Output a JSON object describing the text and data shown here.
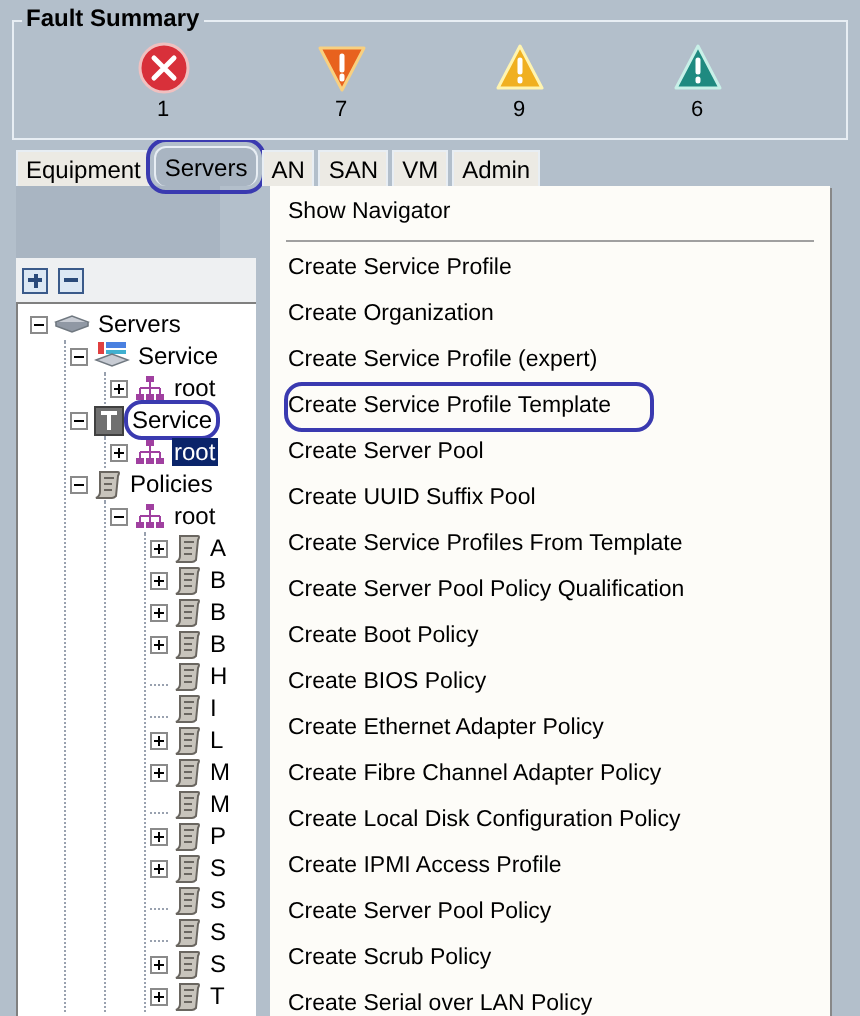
{
  "fault_summary": {
    "title": "Fault Summary",
    "faults": [
      {
        "kind": "critical",
        "count": "1"
      },
      {
        "kind": "major",
        "count": "7"
      },
      {
        "kind": "minor",
        "count": "9"
      },
      {
        "kind": "warning",
        "count": "6"
      }
    ]
  },
  "tabs": [
    {
      "label": "Equipment",
      "selected": false,
      "annotated": false
    },
    {
      "label": "Servers",
      "selected": true,
      "annotated": true
    },
    {
      "label": "AN",
      "selected": false,
      "annotated": false
    },
    {
      "label": "SAN",
      "selected": false,
      "annotated": false
    },
    {
      "label": "VM",
      "selected": false,
      "annotated": false
    },
    {
      "label": "Admin",
      "selected": false,
      "annotated": false
    }
  ],
  "toolbar": [
    {
      "kind": "expand"
    },
    {
      "kind": "collapse"
    }
  ],
  "tree": [
    {
      "label": "Servers",
      "kind": "server",
      "expandable": true,
      "expanded": true,
      "selected": false,
      "annotated": false,
      "children": [
        {
          "label": "Service",
          "kind": "profile",
          "expandable": true,
          "expanded": true,
          "selected": false,
          "annotated": false,
          "children": [
            {
              "label": "root",
              "kind": "org",
              "expandable": true,
              "expanded": false,
              "selected": false,
              "annotated": false
            }
          ]
        },
        {
          "label": "Service",
          "kind": "template",
          "expandable": true,
          "expanded": true,
          "selected": false,
          "annotated": true,
          "children": [
            {
              "label": "root",
              "kind": "org",
              "expandable": true,
              "expanded": false,
              "selected": true,
              "annotated": false
            }
          ]
        },
        {
          "label": "Policies",
          "kind": "policy",
          "expandable": true,
          "expanded": true,
          "selected": false,
          "annotated": false,
          "children": [
            {
              "label": "root",
              "kind": "org",
              "expandable": true,
              "expanded": true,
              "selected": false,
              "annotated": false,
              "children": [
                {
                  "label": "A",
                  "kind": "policy",
                  "expandable": true,
                  "expanded": false,
                  "selected": false,
                  "annotated": false
                },
                {
                  "label": "B",
                  "kind": "policy",
                  "expandable": true,
                  "expanded": false,
                  "selected": false,
                  "annotated": false
                },
                {
                  "label": "B",
                  "kind": "policy",
                  "expandable": true,
                  "expanded": false,
                  "selected": false,
                  "annotated": false
                },
                {
                  "label": "B",
                  "kind": "policy",
                  "expandable": true,
                  "expanded": false,
                  "selected": false,
                  "annotated": false
                },
                {
                  "label": "H",
                  "kind": "policy",
                  "expandable": false,
                  "selected": false,
                  "annotated": false
                },
                {
                  "label": "I",
                  "kind": "policy",
                  "expandable": false,
                  "selected": false,
                  "annotated": false
                },
                {
                  "label": "L",
                  "kind": "policy",
                  "expandable": true,
                  "expanded": false,
                  "selected": false,
                  "annotated": false
                },
                {
                  "label": "M",
                  "kind": "policy",
                  "expandable": true,
                  "expanded": false,
                  "selected": false,
                  "annotated": false
                },
                {
                  "label": "M",
                  "kind": "policy",
                  "expandable": false,
                  "selected": false,
                  "annotated": false
                },
                {
                  "label": "P",
                  "kind": "policy",
                  "expandable": true,
                  "expanded": false,
                  "selected": false,
                  "annotated": false
                },
                {
                  "label": "S",
                  "kind": "policy",
                  "expandable": true,
                  "expanded": false,
                  "selected": false,
                  "annotated": false
                },
                {
                  "label": "S",
                  "kind": "policy",
                  "expandable": false,
                  "selected": false,
                  "annotated": false
                },
                {
                  "label": "S",
                  "kind": "policy",
                  "expandable": false,
                  "selected": false,
                  "annotated": false
                },
                {
                  "label": "S",
                  "kind": "policy",
                  "expandable": true,
                  "expanded": false,
                  "selected": false,
                  "annotated": false
                },
                {
                  "label": "T",
                  "kind": "policy",
                  "expandable": true,
                  "expanded": false,
                  "selected": false,
                  "annotated": false
                }
              ]
            }
          ]
        }
      ]
    }
  ],
  "context_menu": [
    {
      "label": "Show Navigator",
      "separator_after": true,
      "annotated": false
    },
    {
      "label": "Create Service Profile",
      "separator_after": false,
      "annotated": false
    },
    {
      "label": "Create Organization",
      "separator_after": false,
      "annotated": false
    },
    {
      "label": "Create Service Profile (expert)",
      "separator_after": false,
      "annotated": false
    },
    {
      "label": "Create Service Profile Template",
      "separator_after": false,
      "annotated": true
    },
    {
      "label": "Create Server Pool",
      "separator_after": false,
      "annotated": false
    },
    {
      "label": "Create UUID Suffix Pool",
      "separator_after": false,
      "annotated": false
    },
    {
      "label": "Create Service Profiles From Template",
      "separator_after": false,
      "annotated": false
    },
    {
      "label": "Create Server Pool Policy Qualification",
      "separator_after": false,
      "annotated": false
    },
    {
      "label": "Create Boot Policy",
      "separator_after": false,
      "annotated": false
    },
    {
      "label": "Create BIOS Policy",
      "separator_after": false,
      "annotated": false
    },
    {
      "label": "Create Ethernet Adapter Policy",
      "separator_after": false,
      "annotated": false
    },
    {
      "label": "Create Fibre Channel Adapter Policy",
      "separator_after": false,
      "annotated": false
    },
    {
      "label": "Create Local Disk Configuration Policy",
      "separator_after": false,
      "annotated": false
    },
    {
      "label": "Create IPMI Access Profile",
      "separator_after": false,
      "annotated": false
    },
    {
      "label": "Create Server Pool Policy",
      "separator_after": false,
      "annotated": false
    },
    {
      "label": "Create Scrub Policy",
      "separator_after": false,
      "annotated": false
    },
    {
      "label": "Create Serial over LAN Policy",
      "separator_after": false,
      "annotated": false
    }
  ]
}
